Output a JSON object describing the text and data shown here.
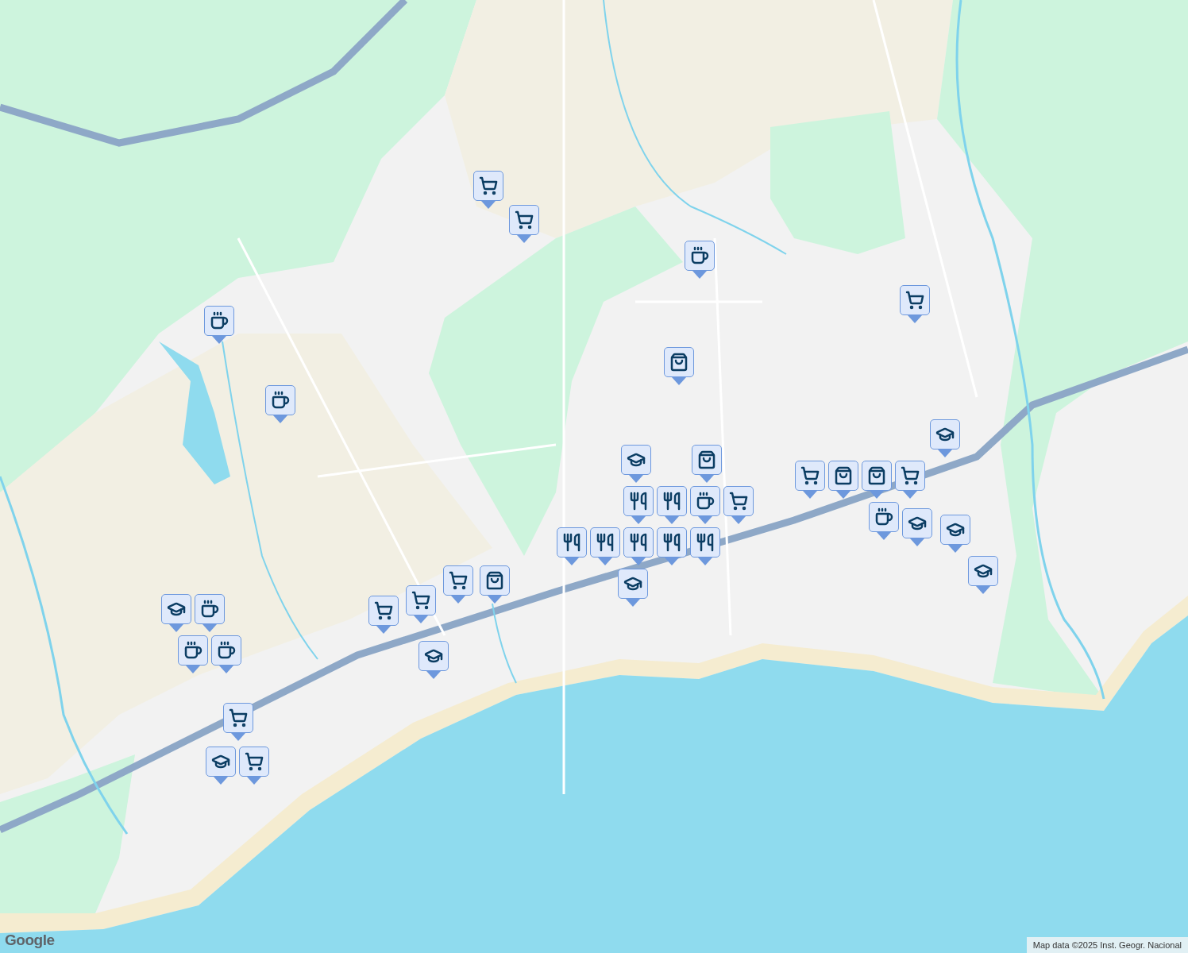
{
  "markers": [
    {
      "kind": "shop"
    },
    {
      "kind": "shop"
    },
    {
      "kind": "cafe"
    },
    {
      "kind": "cafe"
    },
    {
      "kind": "cafe"
    },
    {
      "kind": "bag"
    },
    {
      "kind": "shop"
    },
    {
      "kind": "school"
    },
    {
      "kind": "bag"
    },
    {
      "kind": "restaurant"
    },
    {
      "kind": "restaurant"
    },
    {
      "kind": "cafe"
    },
    {
      "kind": "shop"
    },
    {
      "kind": "restaurant"
    },
    {
      "kind": "restaurant"
    },
    {
      "kind": "restaurant"
    },
    {
      "kind": "restaurant"
    },
    {
      "kind": "restaurant"
    },
    {
      "kind": "school"
    },
    {
      "kind": "shop"
    },
    {
      "kind": "bag"
    },
    {
      "kind": "shop"
    },
    {
      "kind": "shop"
    },
    {
      "kind": "school"
    },
    {
      "kind": "school"
    },
    {
      "kind": "cafe"
    },
    {
      "kind": "cafe"
    },
    {
      "kind": "cafe"
    },
    {
      "kind": "shop"
    },
    {
      "kind": "shop"
    },
    {
      "kind": "school"
    },
    {
      "kind": "shop"
    },
    {
      "kind": "bag"
    },
    {
      "kind": "bag"
    },
    {
      "kind": "shop"
    },
    {
      "kind": "school"
    },
    {
      "kind": "cafe"
    },
    {
      "kind": "school"
    },
    {
      "kind": "school"
    },
    {
      "kind": "school"
    }
  ],
  "logo": "Google",
  "attribution": "Map data ©2025 Inst. Geogr. Nacional"
}
